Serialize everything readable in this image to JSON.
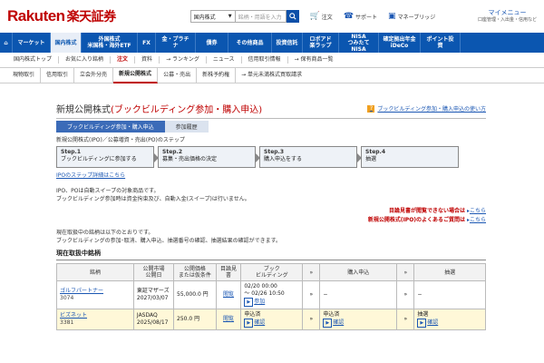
{
  "header": {
    "logo_main": "Rakuten",
    "logo_sub": "楽天証券",
    "search_select": "国内株式",
    "search_placeholder": "銘柄・用語を入力",
    "order": "注文",
    "support": "サポート",
    "bridge": "マネーブリッジ",
    "mypage": "マイメニュー",
    "mypage_sub": "口座管理・入出金・信用など"
  },
  "nav": [
    {
      "label": "ホーム"
    },
    {
      "label": "マーケット"
    },
    {
      "label": "国内株式",
      "active": true
    },
    {
      "label": "外国株式",
      "sub": "米国株・海外ETF"
    },
    {
      "label": "投資信託"
    },
    {
      "label": "FX"
    },
    {
      "label": "金・プラチナ"
    },
    {
      "label": "債券"
    },
    {
      "label": "その他商品"
    },
    {
      "label": "投資信託"
    },
    {
      "label": "ロボアド",
      "sub": "楽ラップ"
    },
    {
      "label": "NISA",
      "sub": "つみたてNISA"
    },
    {
      "label": "確定拠出年金",
      "sub": "iDeCo"
    },
    {
      "label": "ポイント投資"
    }
  ],
  "subnav": [
    "国内株式トップ",
    "お気に入り銘柄",
    "注文",
    "資料",
    "→ ランキング",
    "ニュース",
    "信用取引情報",
    "→ 保有商品一覧"
  ],
  "subnav2": [
    "現物取引",
    "信用取引",
    "立会外分売",
    "新規公開株式",
    "公募・売出",
    "新株予約権",
    "→ 単元未満株式買取請求"
  ],
  "main": {
    "title_black": "新規公開株式",
    "title_red": "(ブックビルディング参加・購入申込)",
    "help_link": "ブックビルディング参加・購入申込の使い方",
    "tab_active": "ブックビルディング参加・購入申込",
    "tab_inactive": "参加履歴",
    "steps_label": "新規公開株式(IPO)／公募増資・売出(PO)のステップ",
    "steps": [
      {
        "title": "Step.1",
        "text": "ブックビルディングに参加する"
      },
      {
        "title": "Step.2",
        "text": "募集・売出価格の決定"
      },
      {
        "title": "Step.3",
        "text": "購入申込をする"
      },
      {
        "title": "Step.4",
        "text": "抽選"
      }
    ],
    "step_link": "IPOのステップ詳細はこちら",
    "note1": "IPO、POは自動スイープの対象商品です。",
    "note2": "ブックビルディング参加時は資金拘束及び、自動入金(スイープ)は行いません。",
    "red1": "目論見書が閲覧できない場合は",
    "red1_link": "こちら",
    "red2": "新規公開株式(IPO)のよくあるご質問は",
    "red2_link": "こちら",
    "info1": "現在取扱中の銘柄は以下のとおりです。",
    "info2": "ブックビルディングの参加･取消、購入申込、抽選番号の確認、抽選結果の確認ができます。",
    "table_title": "現在取扱中銘柄"
  },
  "table": {
    "headers": [
      "銘柄",
      "公開市場\n公開日",
      "公開価格\nまたは仮条件",
      "目論見書",
      "ブック\nビルディング",
      "»",
      "購入申込",
      "»",
      "抽選"
    ],
    "rows": [
      {
        "name": "ゴルフパートナー",
        "code": "3074",
        "market": "東証マザーズ",
        "date": "2027/03/07",
        "price": "55,000.0 円",
        "prospectus": "閲覧",
        "bb": "02/20 00:00\n〜 02/26 10:50",
        "bb_btn": "参加",
        "apply": "−",
        "lottery": "−",
        "hl": false
      },
      {
        "name": "ビズネット",
        "code": "3381",
        "market": "JASDAQ",
        "date": "2025/08/17",
        "price": "250.0 円",
        "prospectus": "閲覧",
        "bb": "申込済",
        "bb_btn": "確認",
        "apply": "申込済",
        "apply_btn": "確認",
        "lottery": "抽選",
        "lottery_btn": "確認",
        "hl": true
      }
    ]
  },
  "colors": {
    "brand_red": "#bf0000",
    "nav_blue": "#0b56b0",
    "link_blue": "#1b57b3"
  }
}
